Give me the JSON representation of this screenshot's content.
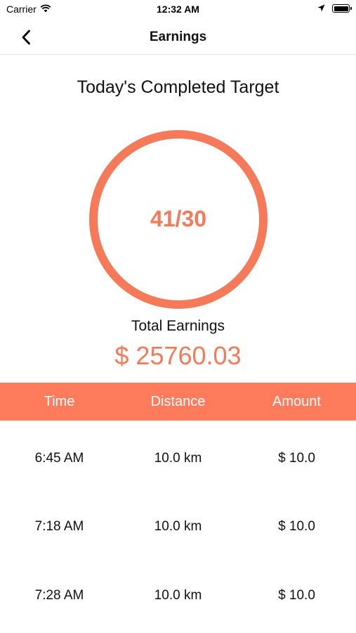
{
  "colors": {
    "accent": "#F47A5A",
    "header_bg": "#FE7B5C"
  },
  "status_bar": {
    "carrier": "Carrier",
    "time": "12:32 AM"
  },
  "nav": {
    "title": "Earnings"
  },
  "target": {
    "title": "Today's Completed Target",
    "progress_text": "41/30",
    "completed": 41,
    "goal": 30
  },
  "earnings": {
    "label": "Total Earnings",
    "value": "$ 25760.03"
  },
  "table": {
    "headers": [
      "Time",
      "Distance",
      "Amount"
    ],
    "rows": [
      [
        "6:45 AM",
        "10.0 km",
        "$ 10.0"
      ],
      [
        "7:18 AM",
        "10.0 km",
        "$ 10.0"
      ],
      [
        "7:28 AM",
        "10.0 km",
        "$ 10.0"
      ]
    ]
  }
}
